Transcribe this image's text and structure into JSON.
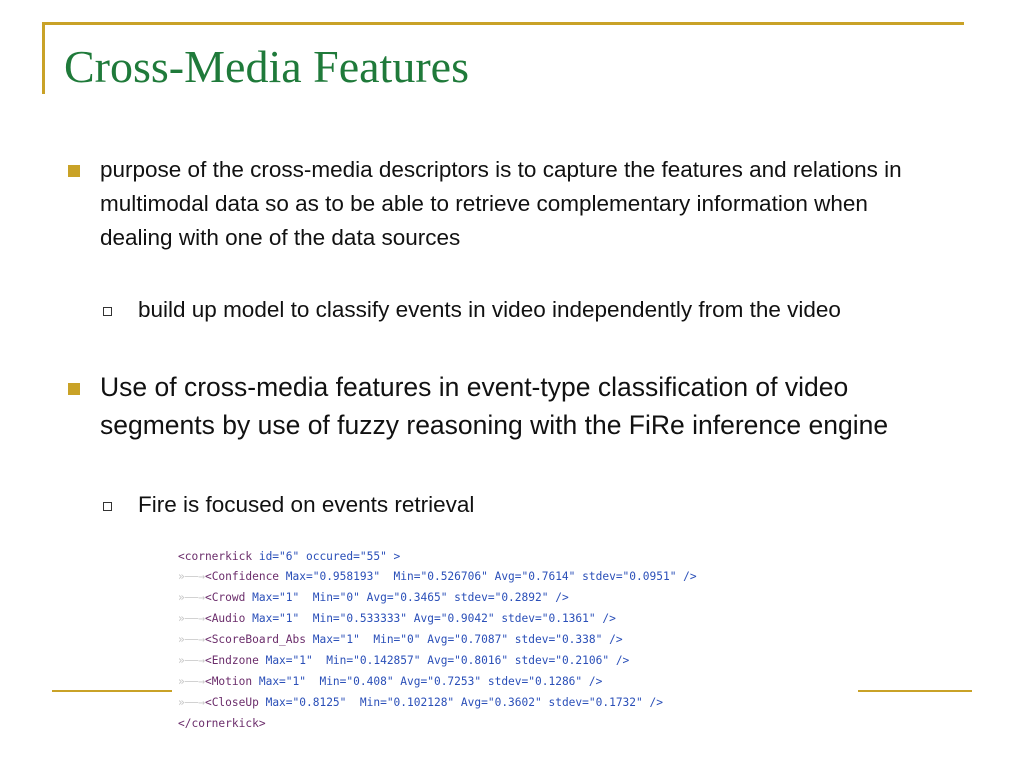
{
  "slide": {
    "title": "Cross-Media Features",
    "bullets": [
      {
        "text": "purpose of the cross-media descriptors is to capture the features and relations in multimodal data so as to be able to retrieve complementary information when dealing with one of the data sources",
        "sub": "build up model to classify events in video independently from the video"
      },
      {
        "text": "Use of cross-media features in event-type classification of video segments by use of fuzzy reasoning with the FiRe inference engine",
        "sub": "Fire is focused on events retrieval"
      }
    ]
  },
  "code": {
    "open_tag": "<cornerkick",
    "open_attrs": " id=\"6\" occured=\"55\" >",
    "lines": [
      {
        "tag": "<Confidence",
        "attrs": " Max=\"0.958193\"  Min=\"0.526706\" Avg=\"0.7614\" stdev=\"0.0951\" />"
      },
      {
        "tag": "<Crowd",
        "attrs": " Max=\"1\"  Min=\"0\" Avg=\"0.3465\" stdev=\"0.2892\" />"
      },
      {
        "tag": "<Audio",
        "attrs": " Max=\"1\"  Min=\"0.533333\" Avg=\"0.9042\" stdev=\"0.1361\" />"
      },
      {
        "tag": "<ScoreBoard_Abs",
        "attrs": " Max=\"1\"  Min=\"0\" Avg=\"0.7087\" stdev=\"0.338\" />"
      },
      {
        "tag": "<Endzone",
        "attrs": " Max=\"1\"  Min=\"0.142857\" Avg=\"0.8016\" stdev=\"0.2106\" />"
      },
      {
        "tag": "<Motion",
        "attrs": " Max=\"1\"  Min=\"0.408\" Avg=\"0.7253\" stdev=\"0.1286\" />"
      },
      {
        "tag": "<CloseUp",
        "attrs": " Max=\"0.8125\"  Min=\"0.102128\" Avg=\"0.3602\" stdev=\"0.1732\" />"
      }
    ],
    "close_tag": "</cornerkick>",
    "indent_glyph": "»——→"
  },
  "colors": {
    "accent": "#c9a227",
    "title": "#1f7a3a",
    "xml_tag": "#6b2d6b",
    "xml_attr": "#2a4fb8"
  }
}
